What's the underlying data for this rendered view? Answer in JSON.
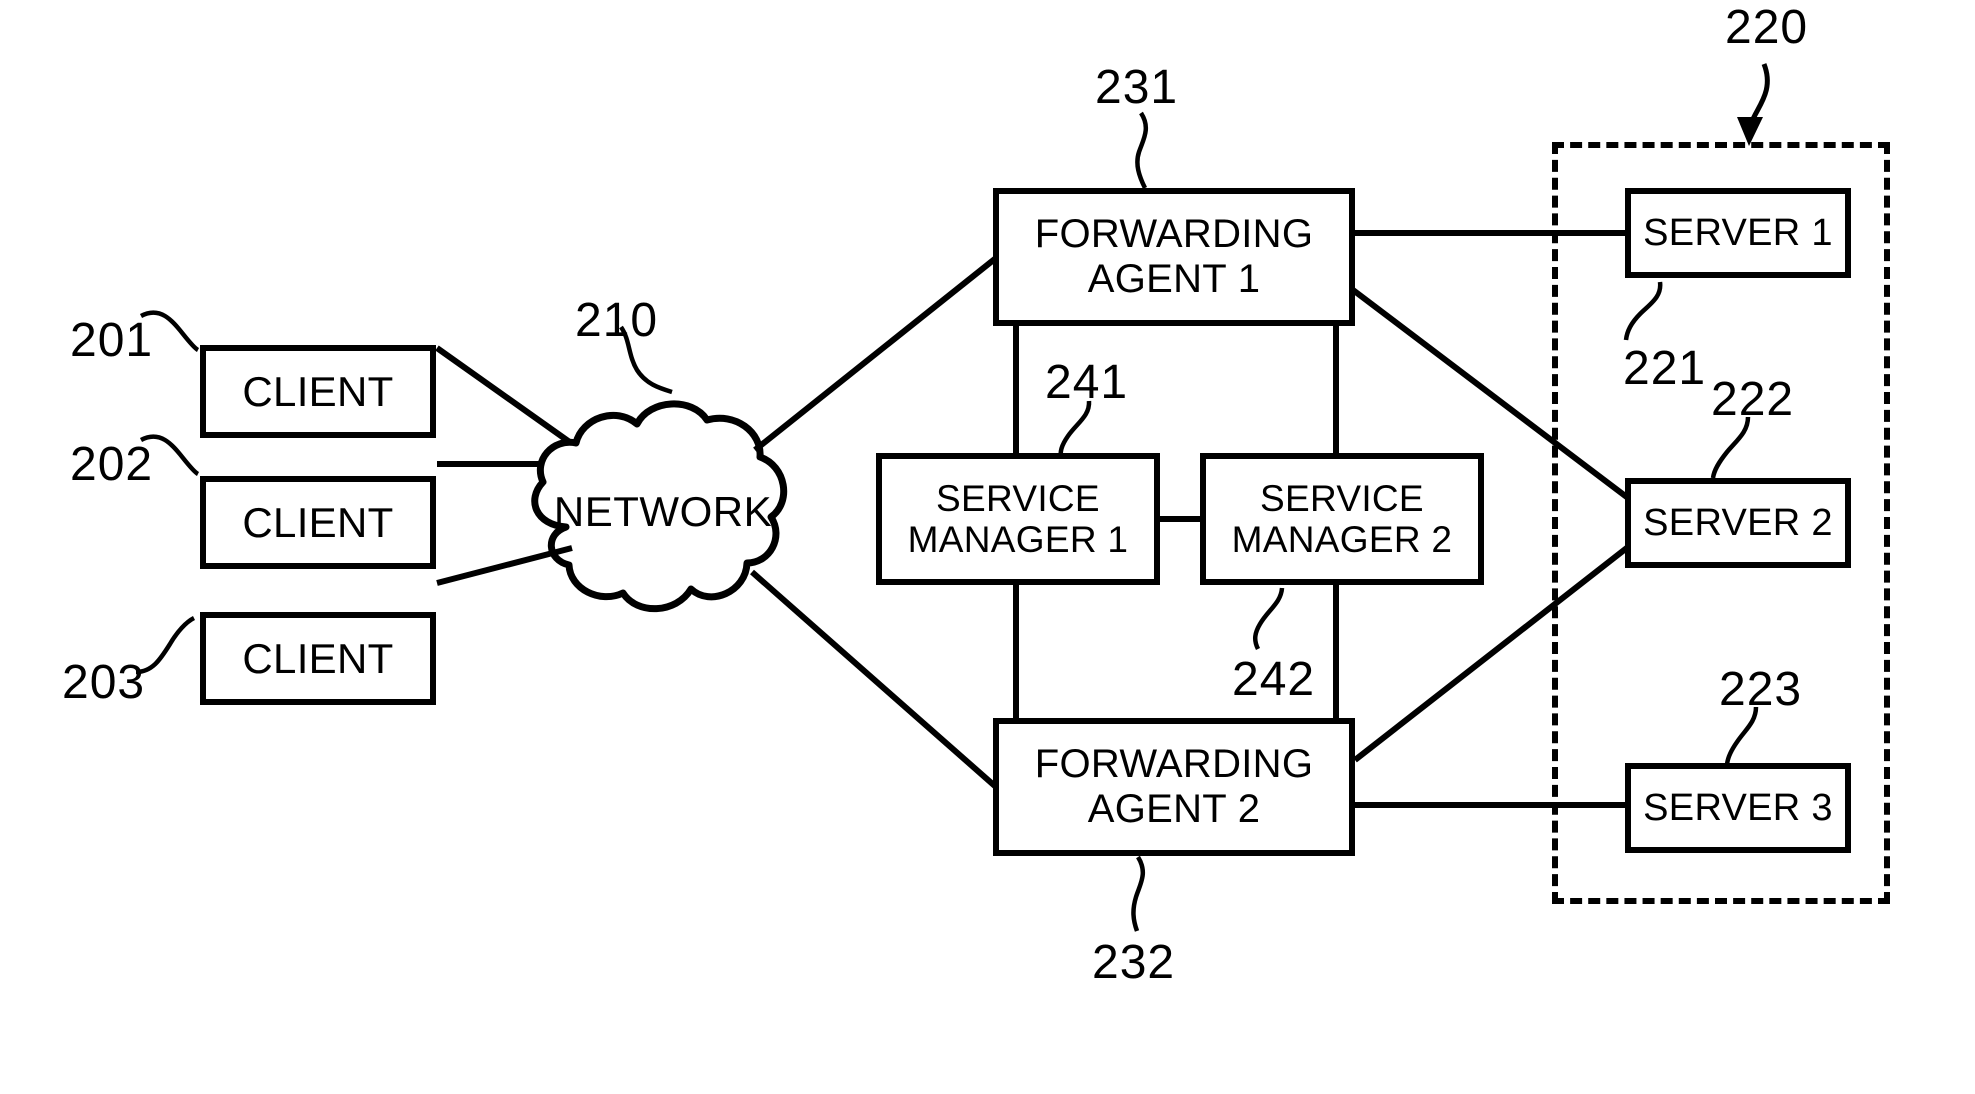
{
  "figure": {
    "type": "patent-network-diagram",
    "background_color": "#ffffff",
    "line_color": "#000000"
  },
  "nodes": {
    "client_1": {
      "label": "CLIENT",
      "ref": "201"
    },
    "client_2": {
      "label": "CLIENT",
      "ref": "202"
    },
    "client_3": {
      "label": "CLIENT",
      "ref": "203"
    },
    "network": {
      "label": "NETWORK",
      "ref": "210"
    },
    "forwarding_agent_1": {
      "label": "FORWARDING\nAGENT 1",
      "ref": "231"
    },
    "forwarding_agent_2": {
      "label": "FORWARDING\nAGENT 2",
      "ref": "232"
    },
    "service_manager_1": {
      "label": "SERVICE\nMANAGER 1",
      "ref": "241"
    },
    "service_manager_2": {
      "label": "SERVICE\nMANAGER 2",
      "ref": "242"
    },
    "server_1": {
      "label": "SERVER 1",
      "ref": "221"
    },
    "server_2": {
      "label": "SERVER 2",
      "ref": "222"
    },
    "server_3": {
      "label": "SERVER 3",
      "ref": "223"
    },
    "server_group": {
      "label": "",
      "ref": "220"
    }
  },
  "reference_numerals": [
    "201",
    "202",
    "203",
    "210",
    "220",
    "221",
    "222",
    "223",
    "231",
    "232",
    "241",
    "242"
  ],
  "connections": [
    {
      "from": "client_1",
      "to": "network"
    },
    {
      "from": "client_2",
      "to": "network"
    },
    {
      "from": "client_3",
      "to": "network"
    },
    {
      "from": "network",
      "to": "forwarding_agent_1"
    },
    {
      "from": "network",
      "to": "forwarding_agent_2"
    },
    {
      "from": "forwarding_agent_1",
      "to": "server_1"
    },
    {
      "from": "forwarding_agent_1",
      "to": "server_2"
    },
    {
      "from": "forwarding_agent_2",
      "to": "server_2"
    },
    {
      "from": "forwarding_agent_2",
      "to": "server_3"
    },
    {
      "from": "forwarding_agent_1",
      "to": "service_manager_1"
    },
    {
      "from": "forwarding_agent_1",
      "to": "service_manager_2"
    },
    {
      "from": "forwarding_agent_2",
      "to": "service_manager_1"
    },
    {
      "from": "forwarding_agent_2",
      "to": "service_manager_2"
    },
    {
      "from": "service_manager_1",
      "to": "service_manager_2"
    }
  ]
}
